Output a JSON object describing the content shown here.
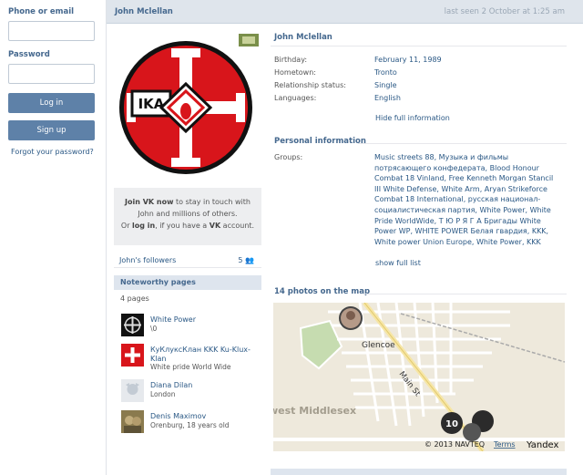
{
  "login": {
    "phone_label": "Phone or email",
    "password_label": "Password",
    "login_button": "Log in",
    "signup_button": "Sign up",
    "forgot_link": "Forgot your password?"
  },
  "header": {
    "name": "John Mclellan",
    "last_seen": "last seen 2 October at 1:25 am"
  },
  "join_box": {
    "line1_bold": "Join VK now",
    "line1_rest": " to stay in touch with",
    "line2": "John and millions of others.",
    "line3_a": "Or ",
    "line3_link": "log in",
    "line3_b": ", if you have a ",
    "line3_vk": "VK",
    "line3_c": " account."
  },
  "avatar": {
    "emblem_text": "IKA"
  },
  "followers": {
    "label": "John's followers",
    "count": "5"
  },
  "noteworthy": {
    "title": "Noteworthy pages",
    "count": "4 pages",
    "items": [
      {
        "name": "White Power",
        "sub": "\\0"
      },
      {
        "name": "КуКлуксКлан KKK Ku-Klux-Klan",
        "sub": "White pride World Wide"
      },
      {
        "name": "Diana Dilan",
        "sub": "London"
      },
      {
        "name": "Denis Maximov",
        "sub": "Orenburg, 18 years old"
      }
    ]
  },
  "profile": {
    "name": "John Mclellan",
    "fields": [
      {
        "key": "Birthday:",
        "value": "February 11, 1989"
      },
      {
        "key": "Hometown:",
        "value": "Tronto"
      },
      {
        "key": "Relationship status:",
        "value": "Single"
      },
      {
        "key": "Languages:",
        "value": "English"
      }
    ],
    "hide_full": "Hide full information",
    "personal_title": "Personal information",
    "groups_key": "Groups:",
    "groups_value": "Music streets 88, Музыка и фильмы потрясающего конфедерата, Blood Honour Combat 18 Vinland, Free Kenneth Morgan Stancil III White Defense, White Arm, Aryan Strikeforce Combat 18 International, русская национал-социалистическая партия, White Power, White Pride WorldWide, Т Ю Р Я Г А Бригады White Power WP, WHITE POWER Белая гвардия, KKK, White power Union Europe, White Power, KKK",
    "show_full": "show full list",
    "photos_title": "14 photos on the map"
  },
  "map": {
    "town_label": "Glencoe",
    "street_label": "Main St",
    "area_label": "west Middlesex",
    "cluster_count": "10",
    "copyright": "© 2013 NAVTEQ",
    "terms": "Terms",
    "brand": "Yandex"
  }
}
